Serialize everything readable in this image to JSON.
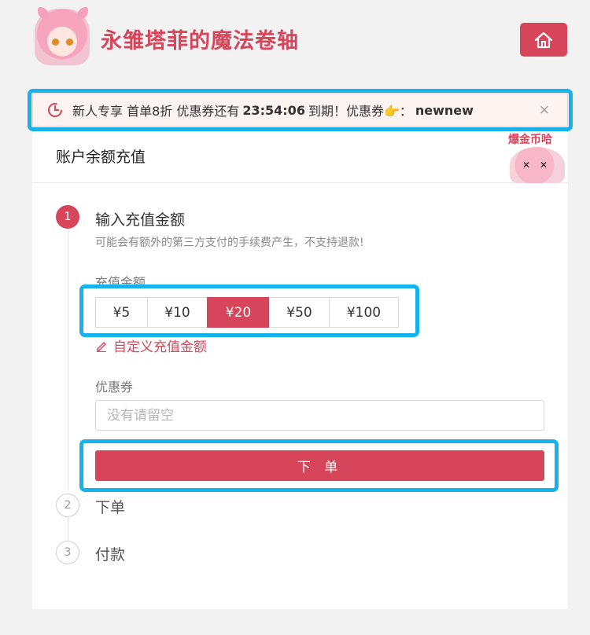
{
  "header": {
    "title": "永雏塔菲的魔法卷轴"
  },
  "notice": {
    "prefix": "新人专享 首单8折 优惠券还有",
    "countdown": "23:54:06",
    "middle": "到期！优惠券👉：",
    "code": "newnew",
    "close": "×"
  },
  "card": {
    "title": "账户余额充值",
    "mascot_sign": "爆金币哈"
  },
  "steps": [
    {
      "number": "1",
      "title": "输入充值金额",
      "desc": "可能会有额外的第三方支付的手续费产生，不支持退款!"
    },
    {
      "number": "2",
      "title": "下单"
    },
    {
      "number": "3",
      "title": "付款"
    }
  ],
  "amount_field": {
    "label": "充值金额",
    "options": [
      "¥5",
      "¥10",
      "¥20",
      "¥50",
      "¥100"
    ],
    "selected": "¥20",
    "custom_label": "自定义充值金额"
  },
  "coupon_field": {
    "label": "优惠券",
    "placeholder": "没有请留空",
    "value": ""
  },
  "order_button": "下 单",
  "colors": {
    "accent": "#d6455a",
    "highlight": "#15b2ec"
  }
}
